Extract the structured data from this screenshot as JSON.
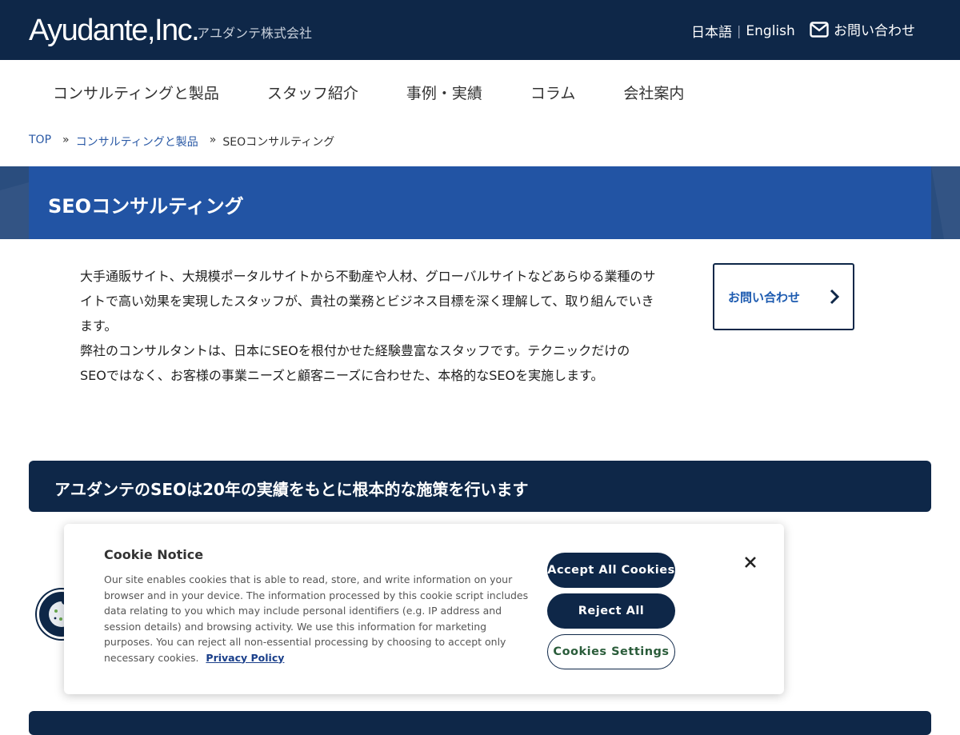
{
  "header": {
    "logo": "Ayudante,Inc.",
    "logo_sub": "アユダンテ株式会社",
    "lang_ja": "日本語",
    "lang_sep": "|",
    "lang_en": "English",
    "contact": "お問い合わせ"
  },
  "nav": {
    "items": [
      "コンサルティングと製品",
      "スタッフ紹介",
      "事例・実績",
      "コラム",
      "会社案内"
    ]
  },
  "breadcrumb": {
    "top": "TOP",
    "sep": "»",
    "parent": "コンサルティングと製品",
    "current": "SEOコンサルティング"
  },
  "page": {
    "title": "SEOコンサルティング",
    "intro_1": "大手通販サイト、大規模ポータルサイトから不動産や人材、グローバルサイトなどあらゆる業種のサイトで高い効果を実現したスタッフが、貴社の業務とビジネス目標を深く理解して、取り組んでいきます。",
    "intro_2": "弊社のコンサルタントは、日本にSEOを根付かせた経験豊富なスタッフです。テクニックだけのSEOではなく、お客様の事業ニーズと顧客ニーズに合わせた、本格的なSEOを実施します。",
    "contact_button": "お問い合わせ",
    "section_heading": "アユダンテのSEOは20年の実績をもとに根本的な施策を行います"
  },
  "cookie": {
    "title": "Cookie Notice",
    "body": "Our site enables cookies that is able to read, store, and write information on your browser and in your device. The information processed by this cookie script includes data relating to you which may include personal identifiers (e.g. IP address and session details) and browsing activity. We use this information for marketing purposes. You can reject all non-essential processing by choosing to accept only necessary cookies.",
    "privacy_link": "Privacy Policy",
    "accept": "Accept All Cookies",
    "reject": "Reject All",
    "settings": "Cookies Settings"
  },
  "colors": {
    "header_bg": "#0e2748",
    "band_bg": "#2254a4",
    "link": "#2b5aa6"
  }
}
